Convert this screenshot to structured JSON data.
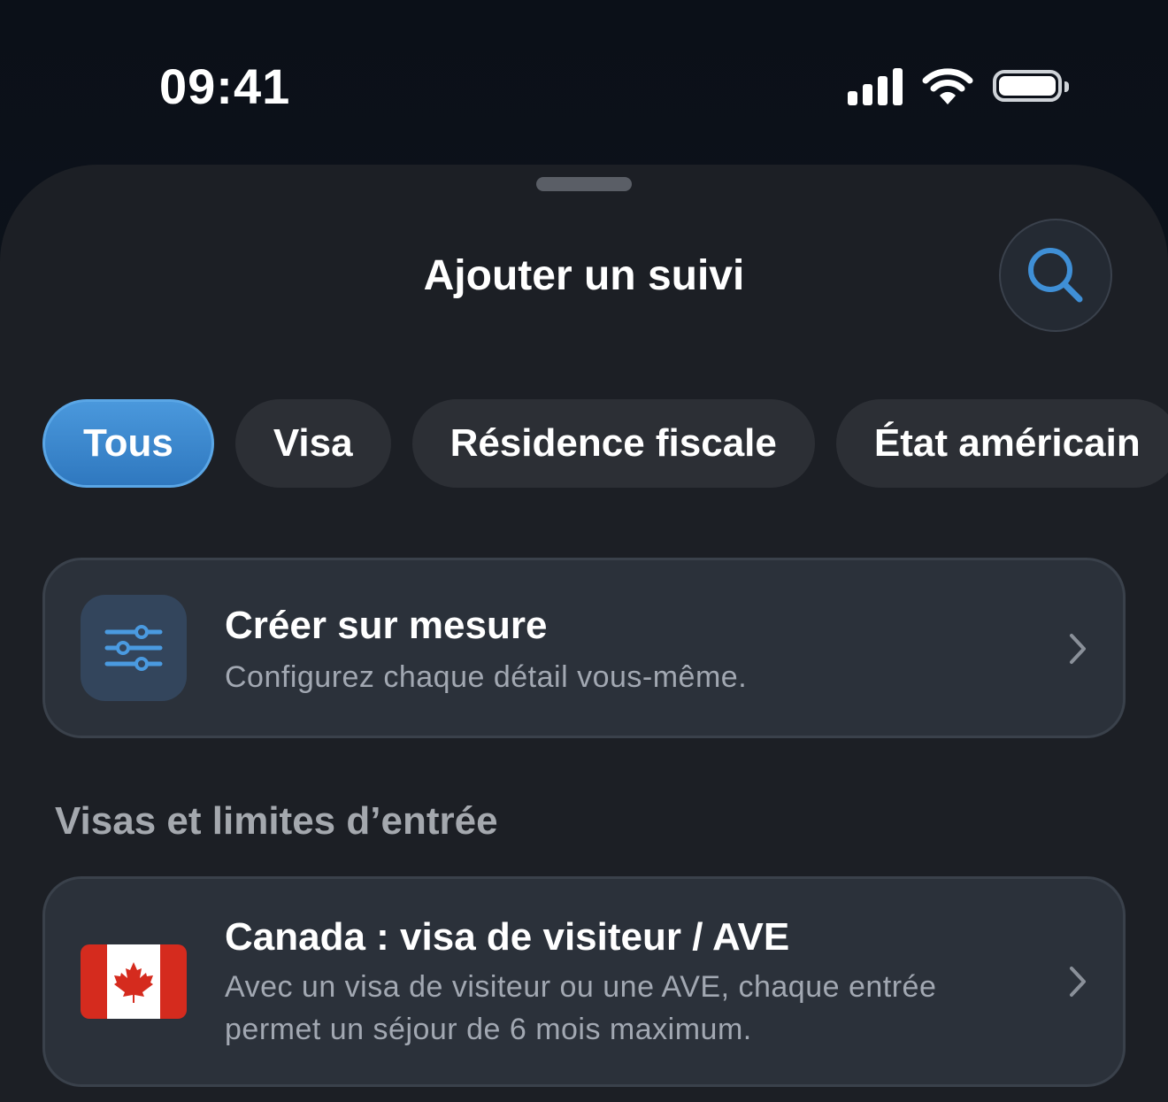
{
  "status_bar": {
    "time": "09:41"
  },
  "sheet": {
    "title": "Ajouter un suivi"
  },
  "filters": [
    {
      "label": "Tous",
      "active": true
    },
    {
      "label": "Visa",
      "active": false
    },
    {
      "label": "Résidence fiscale",
      "active": false
    },
    {
      "label": "État américain",
      "active": false
    }
  ],
  "custom_card": {
    "title": "Créer sur mesure",
    "subtitle": "Configurez chaque détail vous-même."
  },
  "section": {
    "title": "Visas et limites d’entrée"
  },
  "visa_card": {
    "title": "Canada : visa de visiteur / AVE",
    "subtitle": "Avec un visa de visiteur ou une AVE, chaque entrée permet un séjour de 6 mois maximum."
  },
  "colors": {
    "accent": "#3f8fd6",
    "sheet_bg": "#1c1f25",
    "card_bg": "#2b313a",
    "flag_red": "#d52b1e"
  },
  "icons": {
    "search": "search-icon",
    "sliders": "sliders-icon",
    "chevron": "chevron-right-icon",
    "flag": "canada-flag-icon"
  }
}
